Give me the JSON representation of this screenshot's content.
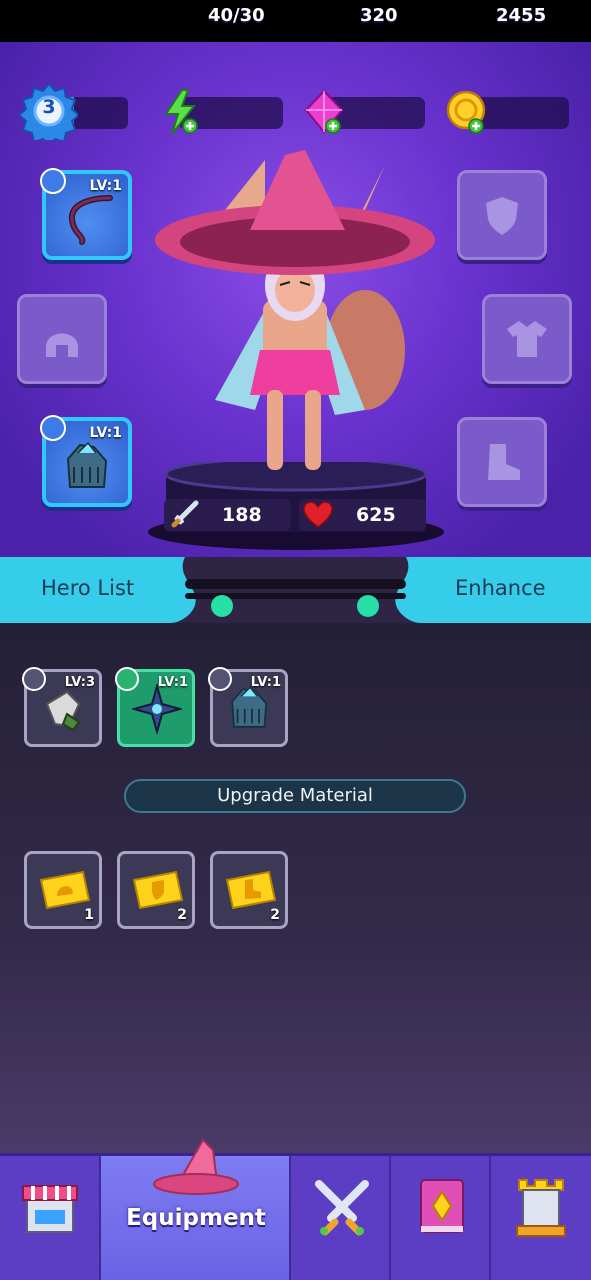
{
  "player": {
    "level": "3",
    "xp_fraction": 0.2
  },
  "resources": {
    "energy": "40/30",
    "gems": "320",
    "gold": "2455"
  },
  "equipment_slots": {
    "weapon_level": "LV:1",
    "gloves_level": "LV:1"
  },
  "hero_stats": {
    "attack": "188",
    "health": "625"
  },
  "tabs": {
    "left": "Hero List",
    "right": "Enhance"
  },
  "equipment_cards": [
    {
      "level": "LV:3",
      "item": "gauntlet"
    },
    {
      "level": "LV:1",
      "item": "shuriken"
    },
    {
      "level": "LV:1",
      "item": "armored-glove"
    }
  ],
  "upgrade": {
    "label": "Upgrade Material",
    "materials": [
      {
        "icon": "helmet-ticket",
        "count": "1"
      },
      {
        "icon": "armor-ticket",
        "count": "2"
      },
      {
        "icon": "boot-ticket",
        "count": "2"
      }
    ]
  },
  "nav": {
    "active_label": "Equipment"
  },
  "colors": {
    "accent_cyan": "#31c8ff",
    "panel_purple": "#6a33cf",
    "nav_active": "#7e7cf2"
  }
}
